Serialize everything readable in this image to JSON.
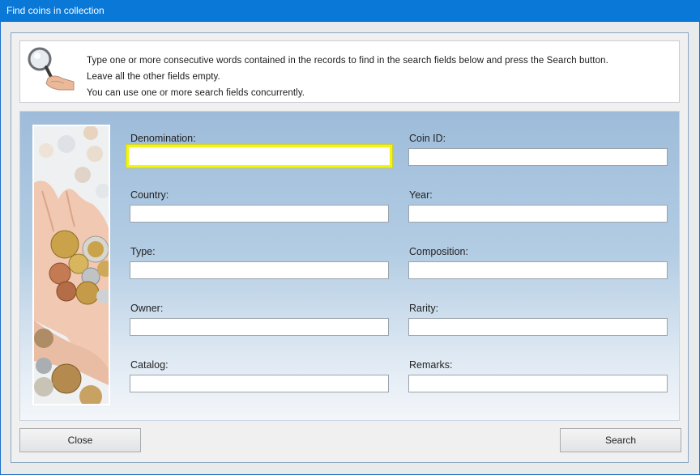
{
  "window": {
    "title": "Find coins in collection"
  },
  "info": {
    "line1": "Type one or more consecutive words contained in the records to find in the search fields below and press the Search button.",
    "line2": "Leave all the other fields empty.",
    "line3": "You can use one or more search fields concurrently."
  },
  "fields": {
    "denomination": {
      "label": "Denomination:",
      "value": ""
    },
    "coin_id": {
      "label": "Coin ID:",
      "value": ""
    },
    "country": {
      "label": "Country:",
      "value": ""
    },
    "year": {
      "label": "Year:",
      "value": ""
    },
    "type": {
      "label": "Type:",
      "value": ""
    },
    "composition": {
      "label": "Composition:",
      "value": ""
    },
    "owner": {
      "label": "Owner:",
      "value": ""
    },
    "rarity": {
      "label": "Rarity:",
      "value": ""
    },
    "catalog": {
      "label": "Catalog:",
      "value": ""
    },
    "remarks": {
      "label": "Remarks:",
      "value": ""
    }
  },
  "buttons": {
    "close": "Close",
    "search": "Search"
  },
  "icons": {
    "info": "magnifier-hand-icon",
    "photo": "coins-in-hand-image"
  },
  "colors": {
    "titlebar": "#0a78d7",
    "focus_border": "#f2f50c"
  }
}
